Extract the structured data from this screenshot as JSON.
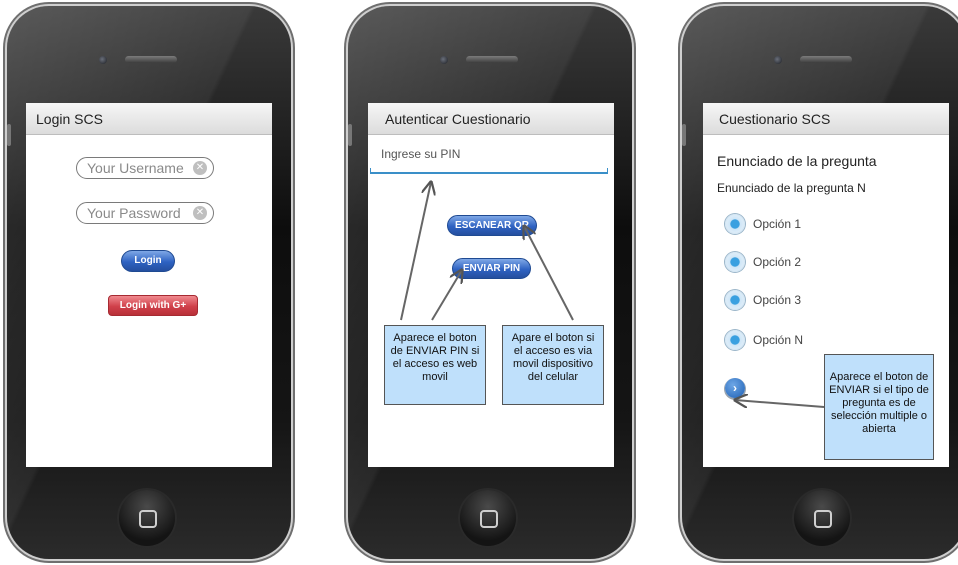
{
  "screens": [
    {
      "title": "Login SCS",
      "username_placeholder": "Your Username",
      "password_placeholder": "Your Password",
      "login_label": "Login",
      "google_login_label": "Login with G+"
    },
    {
      "title": "Autenticar Cuestionario",
      "pin_placeholder": "Ingrese su PIN",
      "scan_qr_label": "ESCANEAR QR",
      "send_pin_label": "ENVIAR PIN",
      "note_left": "Aparece el boton de ENVIAR PIN si el acceso es web movil",
      "note_right": "Apare el boton si el acceso es via movil dispositivo del celular"
    },
    {
      "title": "Cuestionario SCS",
      "question_1": "Enunciado de la pregunta",
      "question_n": "Enunciado de la pregunta N",
      "options": [
        "Opción 1",
        "Opción 2",
        "Opción 3",
        "Opción N"
      ],
      "note": "Aparece el boton de ENVIAR si el tipo de pregunta es de selección multiple o abierta"
    }
  ],
  "icons": {
    "clear": "clear-icon",
    "home": "home-square-icon",
    "next": "chevron-right-icon"
  },
  "colors": {
    "accent_blue": "#2e62c2",
    "google_red": "#d0404a",
    "note_fill": "#bfe0fb",
    "radio_blue": "#3aa0e0"
  }
}
